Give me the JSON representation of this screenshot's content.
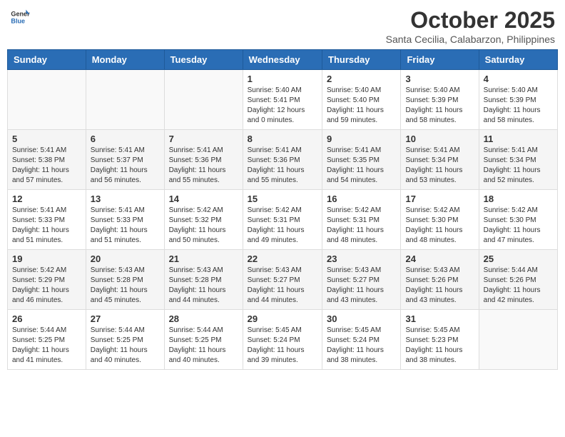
{
  "header": {
    "logo_general": "General",
    "logo_blue": "Blue",
    "month_title": "October 2025",
    "location": "Santa Cecilia, Calabarzon, Philippines"
  },
  "weekdays": [
    "Sunday",
    "Monday",
    "Tuesday",
    "Wednesday",
    "Thursday",
    "Friday",
    "Saturday"
  ],
  "weeks": [
    [
      {
        "day": "",
        "info": ""
      },
      {
        "day": "",
        "info": ""
      },
      {
        "day": "",
        "info": ""
      },
      {
        "day": "1",
        "info": "Sunrise: 5:40 AM\nSunset: 5:41 PM\nDaylight: 12 hours\nand 0 minutes."
      },
      {
        "day": "2",
        "info": "Sunrise: 5:40 AM\nSunset: 5:40 PM\nDaylight: 11 hours\nand 59 minutes."
      },
      {
        "day": "3",
        "info": "Sunrise: 5:40 AM\nSunset: 5:39 PM\nDaylight: 11 hours\nand 58 minutes."
      },
      {
        "day": "4",
        "info": "Sunrise: 5:40 AM\nSunset: 5:39 PM\nDaylight: 11 hours\nand 58 minutes."
      }
    ],
    [
      {
        "day": "5",
        "info": "Sunrise: 5:41 AM\nSunset: 5:38 PM\nDaylight: 11 hours\nand 57 minutes."
      },
      {
        "day": "6",
        "info": "Sunrise: 5:41 AM\nSunset: 5:37 PM\nDaylight: 11 hours\nand 56 minutes."
      },
      {
        "day": "7",
        "info": "Sunrise: 5:41 AM\nSunset: 5:36 PM\nDaylight: 11 hours\nand 55 minutes."
      },
      {
        "day": "8",
        "info": "Sunrise: 5:41 AM\nSunset: 5:36 PM\nDaylight: 11 hours\nand 55 minutes."
      },
      {
        "day": "9",
        "info": "Sunrise: 5:41 AM\nSunset: 5:35 PM\nDaylight: 11 hours\nand 54 minutes."
      },
      {
        "day": "10",
        "info": "Sunrise: 5:41 AM\nSunset: 5:34 PM\nDaylight: 11 hours\nand 53 minutes."
      },
      {
        "day": "11",
        "info": "Sunrise: 5:41 AM\nSunset: 5:34 PM\nDaylight: 11 hours\nand 52 minutes."
      }
    ],
    [
      {
        "day": "12",
        "info": "Sunrise: 5:41 AM\nSunset: 5:33 PM\nDaylight: 11 hours\nand 51 minutes."
      },
      {
        "day": "13",
        "info": "Sunrise: 5:41 AM\nSunset: 5:33 PM\nDaylight: 11 hours\nand 51 minutes."
      },
      {
        "day": "14",
        "info": "Sunrise: 5:42 AM\nSunset: 5:32 PM\nDaylight: 11 hours\nand 50 minutes."
      },
      {
        "day": "15",
        "info": "Sunrise: 5:42 AM\nSunset: 5:31 PM\nDaylight: 11 hours\nand 49 minutes."
      },
      {
        "day": "16",
        "info": "Sunrise: 5:42 AM\nSunset: 5:31 PM\nDaylight: 11 hours\nand 48 minutes."
      },
      {
        "day": "17",
        "info": "Sunrise: 5:42 AM\nSunset: 5:30 PM\nDaylight: 11 hours\nand 48 minutes."
      },
      {
        "day": "18",
        "info": "Sunrise: 5:42 AM\nSunset: 5:30 PM\nDaylight: 11 hours\nand 47 minutes."
      }
    ],
    [
      {
        "day": "19",
        "info": "Sunrise: 5:42 AM\nSunset: 5:29 PM\nDaylight: 11 hours\nand 46 minutes."
      },
      {
        "day": "20",
        "info": "Sunrise: 5:43 AM\nSunset: 5:28 PM\nDaylight: 11 hours\nand 45 minutes."
      },
      {
        "day": "21",
        "info": "Sunrise: 5:43 AM\nSunset: 5:28 PM\nDaylight: 11 hours\nand 44 minutes."
      },
      {
        "day": "22",
        "info": "Sunrise: 5:43 AM\nSunset: 5:27 PM\nDaylight: 11 hours\nand 44 minutes."
      },
      {
        "day": "23",
        "info": "Sunrise: 5:43 AM\nSunset: 5:27 PM\nDaylight: 11 hours\nand 43 minutes."
      },
      {
        "day": "24",
        "info": "Sunrise: 5:43 AM\nSunset: 5:26 PM\nDaylight: 11 hours\nand 43 minutes."
      },
      {
        "day": "25",
        "info": "Sunrise: 5:44 AM\nSunset: 5:26 PM\nDaylight: 11 hours\nand 42 minutes."
      }
    ],
    [
      {
        "day": "26",
        "info": "Sunrise: 5:44 AM\nSunset: 5:25 PM\nDaylight: 11 hours\nand 41 minutes."
      },
      {
        "day": "27",
        "info": "Sunrise: 5:44 AM\nSunset: 5:25 PM\nDaylight: 11 hours\nand 40 minutes."
      },
      {
        "day": "28",
        "info": "Sunrise: 5:44 AM\nSunset: 5:25 PM\nDaylight: 11 hours\nand 40 minutes."
      },
      {
        "day": "29",
        "info": "Sunrise: 5:45 AM\nSunset: 5:24 PM\nDaylight: 11 hours\nand 39 minutes."
      },
      {
        "day": "30",
        "info": "Sunrise: 5:45 AM\nSunset: 5:24 PM\nDaylight: 11 hours\nand 38 minutes."
      },
      {
        "day": "31",
        "info": "Sunrise: 5:45 AM\nSunset: 5:23 PM\nDaylight: 11 hours\nand 38 minutes."
      },
      {
        "day": "",
        "info": ""
      }
    ]
  ]
}
